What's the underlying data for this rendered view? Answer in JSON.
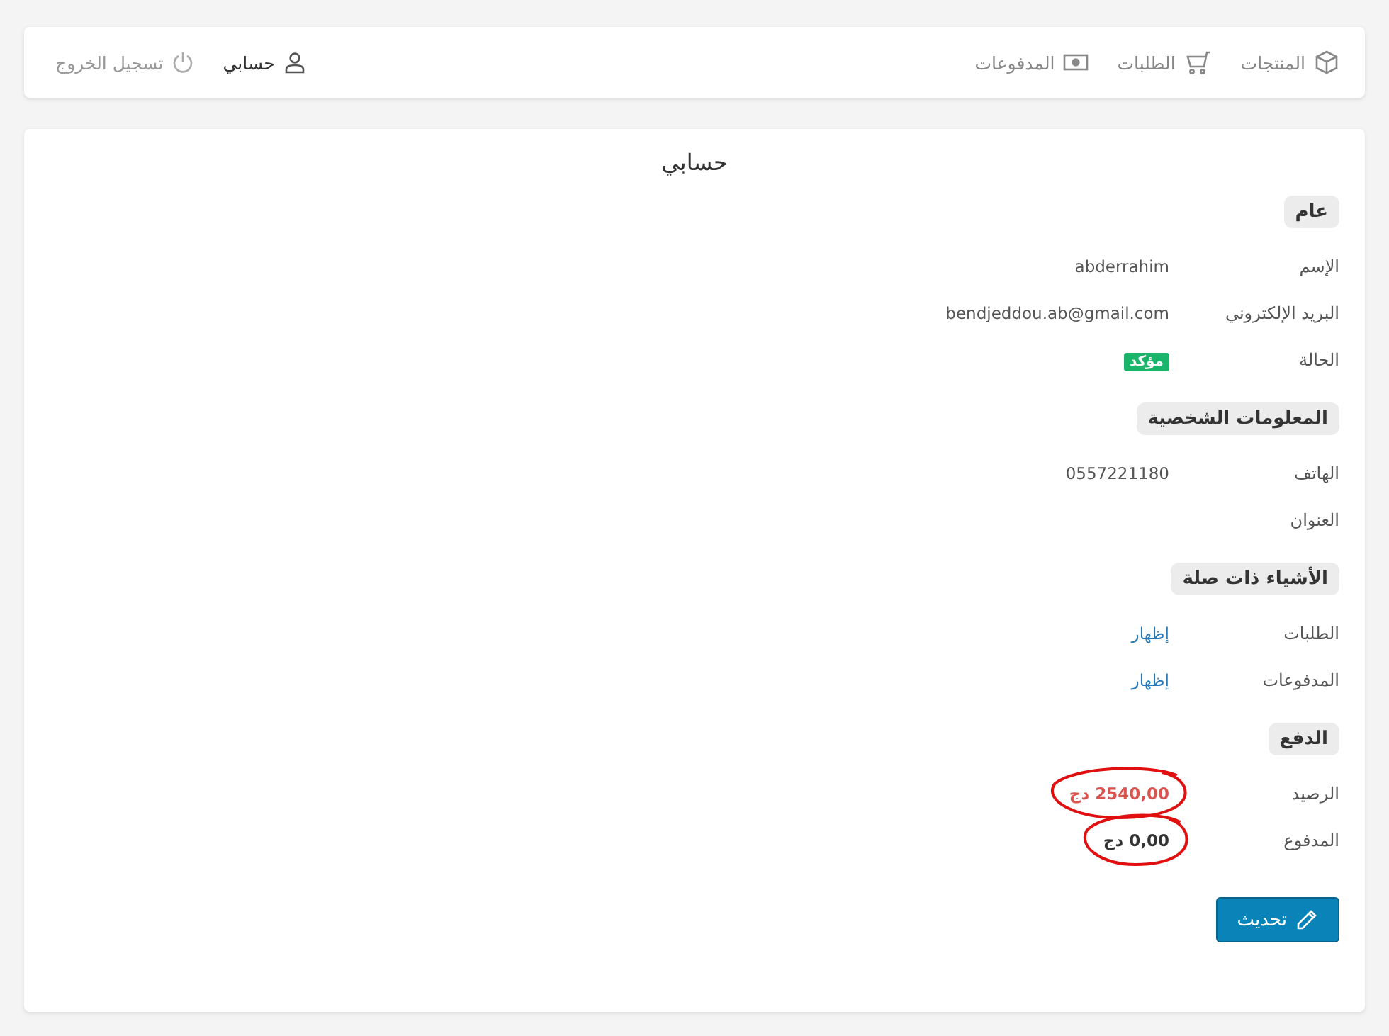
{
  "nav": {
    "links": [
      {
        "label": "المنتجات",
        "kind": "box"
      },
      {
        "label": "الطلبات",
        "kind": "cart"
      },
      {
        "label": "المدفوعات",
        "kind": "money"
      }
    ],
    "account": {
      "label": "حسابي"
    },
    "logout": {
      "label": "تسجيل الخروج"
    }
  },
  "page": {
    "title": "حسابي",
    "sections": [
      {
        "title": "عام",
        "rows": [
          {
            "label": "الإسم",
            "kind": "text",
            "value": "abderrahim",
            "circled": false
          },
          {
            "label": "البريد الإلكتروني",
            "kind": "text",
            "value": "bendjeddou.ab@gmail.com",
            "circled": false
          },
          {
            "label": "الحالة",
            "kind": "badge",
            "value": "مؤكد",
            "circled": false
          }
        ]
      },
      {
        "title": "المعلومات الشخصية",
        "rows": [
          {
            "label": "الهاتف",
            "kind": "text",
            "value": "0557221180",
            "circled": false
          },
          {
            "label": "العنوان",
            "kind": "empty",
            "circled": false
          }
        ]
      },
      {
        "title": "الأشياء ذات صلة",
        "rows": [
          {
            "label": "الطلبات",
            "kind": "link",
            "value": "إظهار",
            "circled": false
          },
          {
            "label": "المدفوعات",
            "kind": "link",
            "value": "إظهار",
            "circled": false
          }
        ]
      },
      {
        "title": "الدفع",
        "rows": [
          {
            "label": "الرصيد",
            "kind": "debt",
            "value": "2540,00 دج",
            "circled": true
          },
          {
            "label": "المدفوع",
            "kind": "amount",
            "value": "0,00 دج",
            "circled": true
          }
        ]
      }
    ],
    "button": {
      "label": "تحديث"
    }
  }
}
